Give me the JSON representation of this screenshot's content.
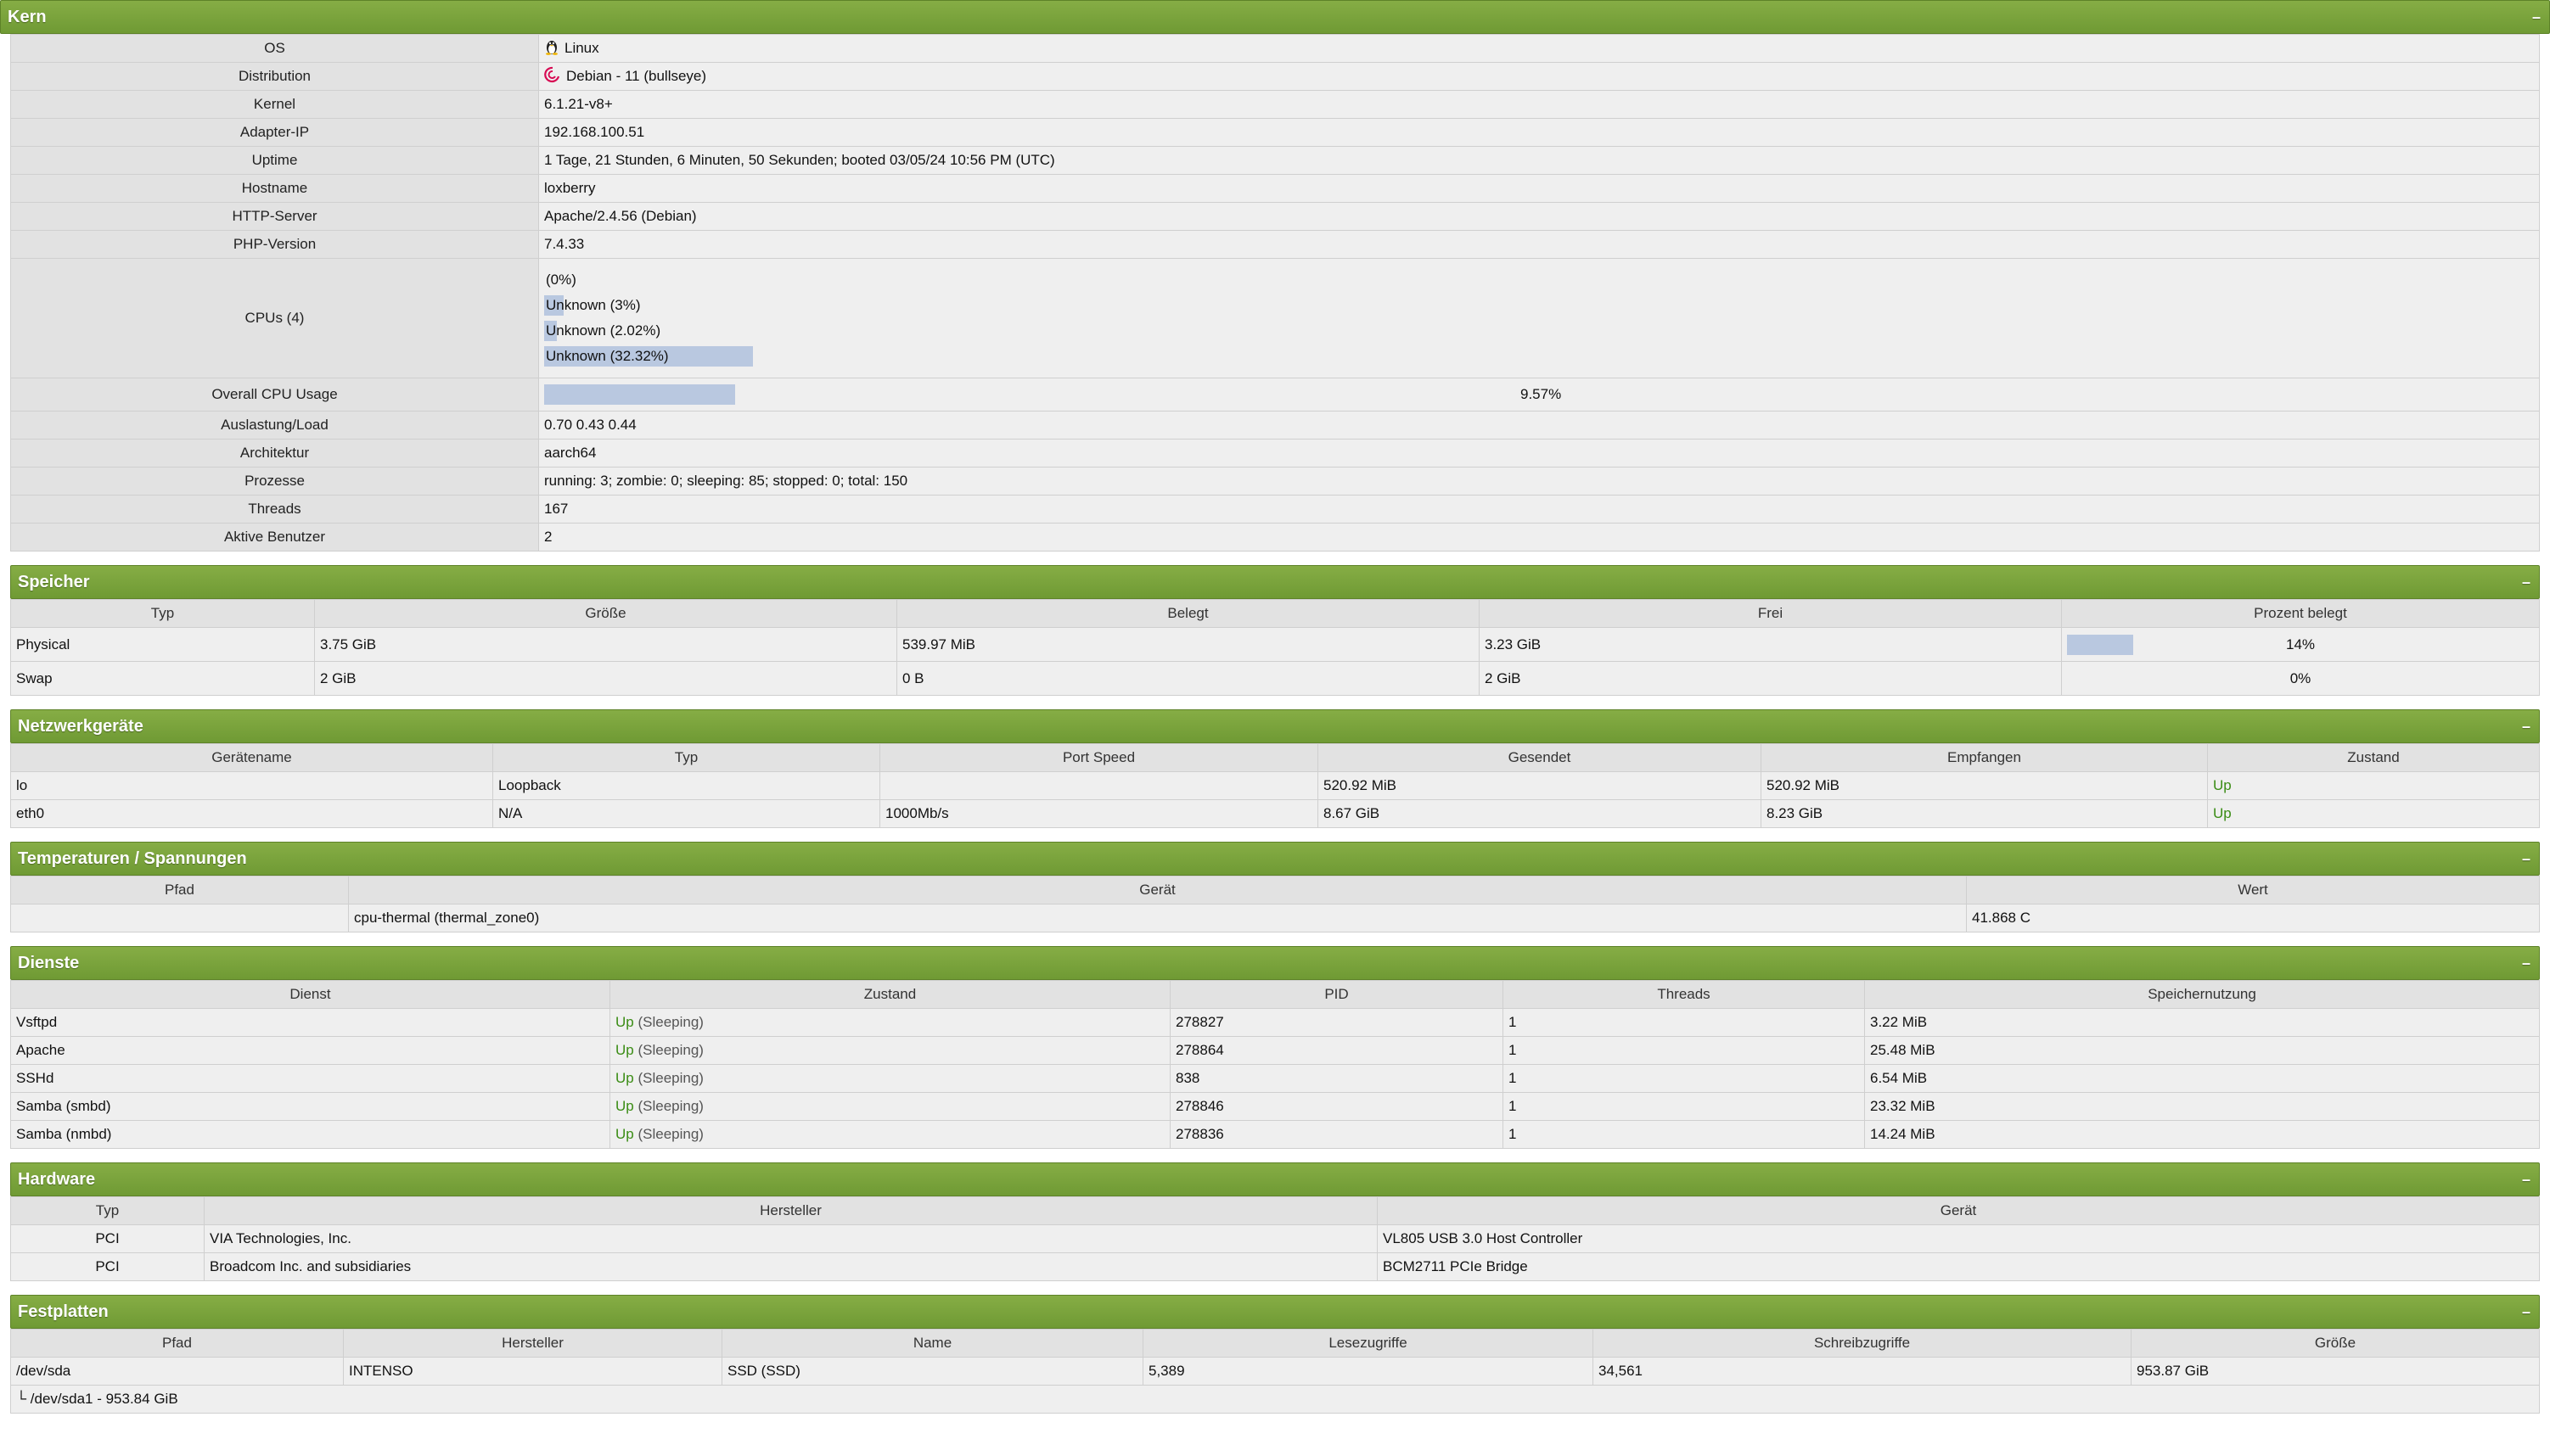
{
  "kern": {
    "title": "Kern",
    "toggle": "–",
    "rows": {
      "os": {
        "label": "OS",
        "value": "Linux"
      },
      "distribution": {
        "label": "Distribution",
        "value": "Debian - 11 (bullseye)"
      },
      "kernel": {
        "label": "Kernel",
        "value": "6.1.21-v8+"
      },
      "adapter_ip": {
        "label": "Adapter-IP",
        "value": "192.168.100.51"
      },
      "uptime": {
        "label": "Uptime",
        "value": "1 Tage, 21 Stunden, 6 Minuten, 50 Sekunden; booted 03/05/24 10:56 PM (UTC)"
      },
      "hostname": {
        "label": "Hostname",
        "value": "loxberry"
      },
      "http_server": {
        "label": "HTTP-Server",
        "value": "Apache/2.4.56 (Debian)"
      },
      "php_version": {
        "label": "PHP-Version",
        "value": "7.4.33"
      },
      "cpus": {
        "label": "CPUs (4)"
      },
      "overall_cpu": {
        "label": "Overall CPU Usage",
        "value": "9.57%",
        "fraction": 0.0957
      },
      "load": {
        "label": "Auslastung/Load",
        "value": "0.70 0.43 0.44"
      },
      "architecture": {
        "label": "Architektur",
        "value": "aarch64"
      },
      "processes": {
        "label": "Prozesse",
        "value": "running: 3; zombie: 0; sleeping: 85; stopped: 0; total: 150"
      },
      "threads": {
        "label": "Threads",
        "value": "167"
      },
      "active_users": {
        "label": "Aktive Benutzer",
        "value": "2"
      }
    },
    "cpu_list": [
      {
        "text": "(0%)",
        "percent": 0
      },
      {
        "text": "Unknown (3%)",
        "percent": 3
      },
      {
        "text": "Unknown (2.02%)",
        "percent": 2.02
      },
      {
        "text": "Unknown (32.32%)",
        "percent": 32.32
      }
    ]
  },
  "speicher": {
    "title": "Speicher",
    "toggle": "–",
    "headers": [
      "Typ",
      "Größe",
      "Belegt",
      "Frei",
      "Prozent belegt"
    ],
    "rows": [
      {
        "type": "Physical",
        "size": "3.75 GiB",
        "used": "539.97 MiB",
        "free": "3.23 GiB",
        "percent": "14%",
        "fraction": 0.14
      },
      {
        "type": "Swap",
        "size": "2 GiB",
        "used": "0 B",
        "free": "2 GiB",
        "percent": "0%",
        "fraction": 0
      }
    ]
  },
  "netzwerk": {
    "title": "Netzwerkgeräte",
    "toggle": "–",
    "headers": [
      "Gerätename",
      "Typ",
      "Port Speed",
      "Gesendet",
      "Empfangen",
      "Zustand"
    ],
    "rows": [
      {
        "name": "lo",
        "type": "Loopback",
        "speed": "",
        "sent": "520.92 MiB",
        "received": "520.92 MiB",
        "state": "Up"
      },
      {
        "name": "eth0",
        "type": "N/A",
        "speed": "1000Mb/s",
        "sent": "8.67 GiB",
        "received": "8.23 GiB",
        "state": "Up"
      }
    ]
  },
  "temperatur": {
    "title": "Temperaturen / Spannungen",
    "toggle": "–",
    "headers": [
      "Pfad",
      "Gerät",
      "Wert"
    ],
    "rows": [
      {
        "path": "",
        "device": "cpu-thermal (thermal_zone0)",
        "value": "41.868 C"
      }
    ]
  },
  "dienste": {
    "title": "Dienste",
    "toggle": "–",
    "headers": [
      "Dienst",
      "Zustand",
      "PID",
      "Threads",
      "Speichernutzung"
    ],
    "rows": [
      {
        "service": "Vsftpd",
        "state": "Up",
        "detail": " (Sleeping)",
        "pid": "278827",
        "threads": "1",
        "memory": "3.22 MiB"
      },
      {
        "service": "Apache",
        "state": "Up",
        "detail": " (Sleeping)",
        "pid": "278864",
        "threads": "1",
        "memory": "25.48 MiB"
      },
      {
        "service": "SSHd",
        "state": "Up",
        "detail": " (Sleeping)",
        "pid": "838",
        "threads": "1",
        "memory": "6.54 MiB"
      },
      {
        "service": "Samba (smbd)",
        "state": "Up",
        "detail": " (Sleeping)",
        "pid": "278846",
        "threads": "1",
        "memory": "23.32 MiB"
      },
      {
        "service": "Samba (nmbd)",
        "state": "Up",
        "detail": " (Sleeping)",
        "pid": "278836",
        "threads": "1",
        "memory": "14.24 MiB"
      }
    ]
  },
  "hardware": {
    "title": "Hardware",
    "toggle": "–",
    "headers": [
      "Typ",
      "Hersteller",
      "Gerät"
    ],
    "rows": [
      {
        "type": "PCI",
        "vendor": "VIA Technologies, Inc.",
        "device": "VL805 USB 3.0 Host Controller"
      },
      {
        "type": "PCI",
        "vendor": "Broadcom Inc. and subsidiaries",
        "device": "BCM2711 PCIe Bridge"
      }
    ]
  },
  "festplatten": {
    "title": "Festplatten",
    "toggle": "–",
    "headers": [
      "Pfad",
      "Hersteller",
      "Name",
      "Lesezugriffe",
      "Schreibzugriffe",
      "Größe"
    ],
    "rows": [
      {
        "path": "/dev/sda",
        "vendor": "INTENSO",
        "name": "SSD (SSD)",
        "reads": "5,389",
        "writes": "34,561",
        "size": "953.87 GiB"
      }
    ],
    "partition": "└ /dev/sda1 - 953.84 GiB"
  }
}
